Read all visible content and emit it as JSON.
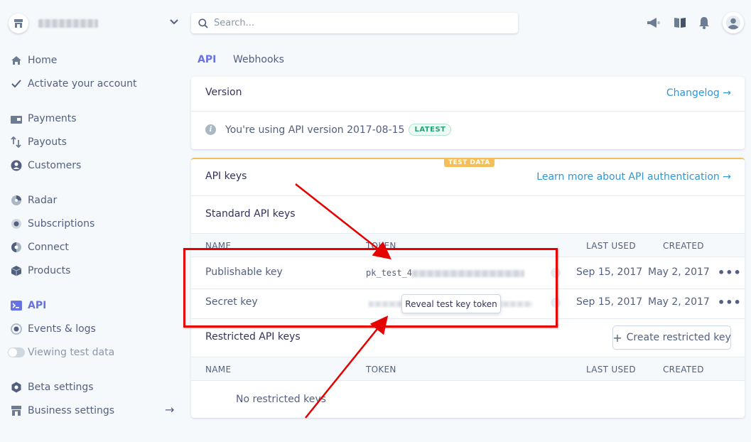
{
  "sidebar": {
    "account_menu": "account-switcher",
    "items": [
      {
        "label": "Home",
        "icon": "home-icon"
      },
      {
        "label": "Activate your account",
        "icon": "check-icon"
      },
      {
        "label": "Payments",
        "icon": "payments-icon"
      },
      {
        "label": "Payouts",
        "icon": "payouts-icon"
      },
      {
        "label": "Customers",
        "icon": "customers-icon"
      },
      {
        "label": "Radar",
        "icon": "radar-icon"
      },
      {
        "label": "Subscriptions",
        "icon": "subscriptions-icon"
      },
      {
        "label": "Connect",
        "icon": "connect-icon"
      },
      {
        "label": "Products",
        "icon": "products-icon"
      },
      {
        "label": "API",
        "icon": "api-icon"
      },
      {
        "label": "Events & logs",
        "icon": "events-icon"
      },
      {
        "label": "Viewing test data",
        "icon": "toggle"
      },
      {
        "label": "Beta settings",
        "icon": "beta-icon"
      },
      {
        "label": "Business settings",
        "icon": "business-icon"
      }
    ]
  },
  "search": {
    "placeholder": "Search..."
  },
  "tabs": [
    {
      "label": "API"
    },
    {
      "label": "Webhooks"
    }
  ],
  "version_card": {
    "title": "Version",
    "changelog_link": "Changelog →",
    "info_text": "You're using API version 2017-08-15",
    "badge": "LATEST"
  },
  "keys_card": {
    "badge": "TEST DATA",
    "title": "API keys",
    "learn_link": "Learn more about API authentication →",
    "standard_title": "Standard API keys",
    "columns": {
      "name": "NAME",
      "token": "TOKEN",
      "last_used": "LAST USED",
      "created": "CREATED"
    },
    "rows": [
      {
        "name": "Publishable key",
        "token_prefix": "pk_test_4",
        "last_used": "Sep 15, 2017",
        "created": "May 2, 2017"
      },
      {
        "name": "Secret key",
        "last_used": "Sep 15, 2017",
        "created": "May 2, 2017"
      }
    ],
    "reveal_tooltip": "Reveal test key token",
    "restricted_title": "Restricted API keys",
    "create_button": "Create restricted key",
    "create_icon": "+",
    "empty_text": "No restricted keys",
    "more_icon": "•••"
  },
  "colors": {
    "accent": "#6772e5",
    "link": "#3297d3",
    "annotation": "#e60000",
    "test_badge": "#f5be58",
    "latest": "#1ea672"
  }
}
